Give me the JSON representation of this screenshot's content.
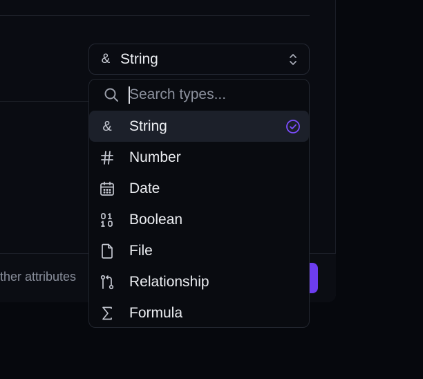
{
  "background": {
    "footer_text": "ther attributes",
    "primary_color": "#6d3df0"
  },
  "select": {
    "icon": "ampersand-icon",
    "value": "String"
  },
  "search": {
    "placeholder": "Search types...",
    "value": ""
  },
  "options": [
    {
      "label": "String",
      "icon": "ampersand-icon",
      "selected": true
    },
    {
      "label": "Number",
      "icon": "hash-icon",
      "selected": false
    },
    {
      "label": "Date",
      "icon": "calendar-icon",
      "selected": false
    },
    {
      "label": "Boolean",
      "icon": "binary-icon",
      "selected": false
    },
    {
      "label": "File",
      "icon": "file-icon",
      "selected": false
    },
    {
      "label": "Relationship",
      "icon": "git-pull-request-icon",
      "selected": false
    },
    {
      "label": "Formula",
      "icon": "sigma-icon",
      "selected": false
    }
  ],
  "colors": {
    "accent": "#7c4dff",
    "selected_row": "#1c202a",
    "border": "#22262f"
  }
}
